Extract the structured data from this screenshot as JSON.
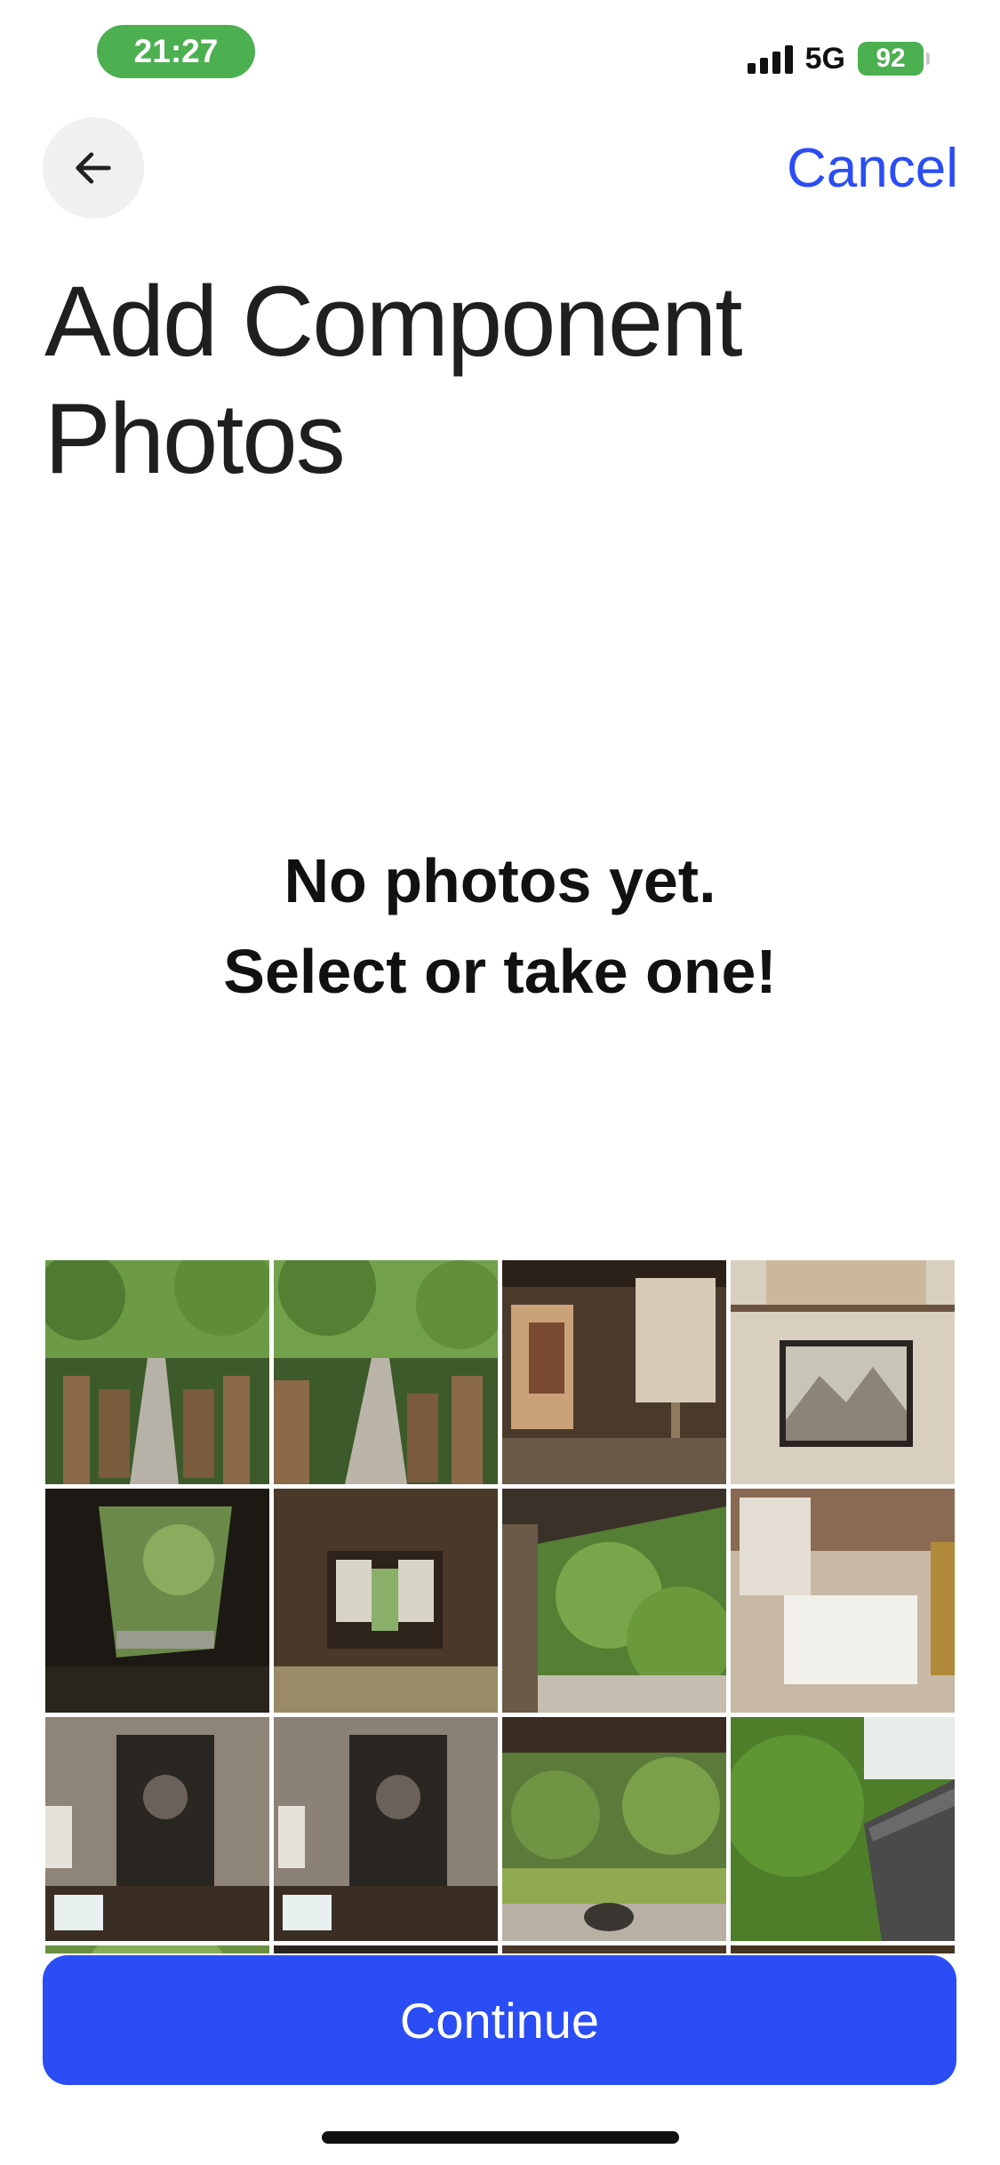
{
  "status_bar": {
    "time": "21:27",
    "network": "5G",
    "battery": "92"
  },
  "nav": {
    "back_icon": "arrow-left-icon",
    "cancel_label": "Cancel"
  },
  "title": "Add Component Photos",
  "empty_state": {
    "line1": "No photos yet.",
    "line2": "Select or take one!"
  },
  "colors": {
    "accent": "#2a4df5",
    "status_green": "#4caf50"
  },
  "photos": [
    {
      "label": "garden bridge path"
    },
    {
      "label": "garden bridge path"
    },
    {
      "label": "temple room with sign"
    },
    {
      "label": "ink landscape screen"
    },
    {
      "label": "view through doorway"
    },
    {
      "label": "tatami room"
    },
    {
      "label": "garden from veranda"
    },
    {
      "label": "room with notice board"
    },
    {
      "label": "portrait scroll alcove"
    },
    {
      "label": "portrait scroll alcove"
    },
    {
      "label": "moss garden under eaves"
    },
    {
      "label": "trees and tiled roof"
    },
    {
      "label": "foliage"
    },
    {
      "label": "foliage"
    },
    {
      "label": "wooden ceiling"
    },
    {
      "label": "wooden ceiling"
    }
  ],
  "continue_label": "Continue"
}
